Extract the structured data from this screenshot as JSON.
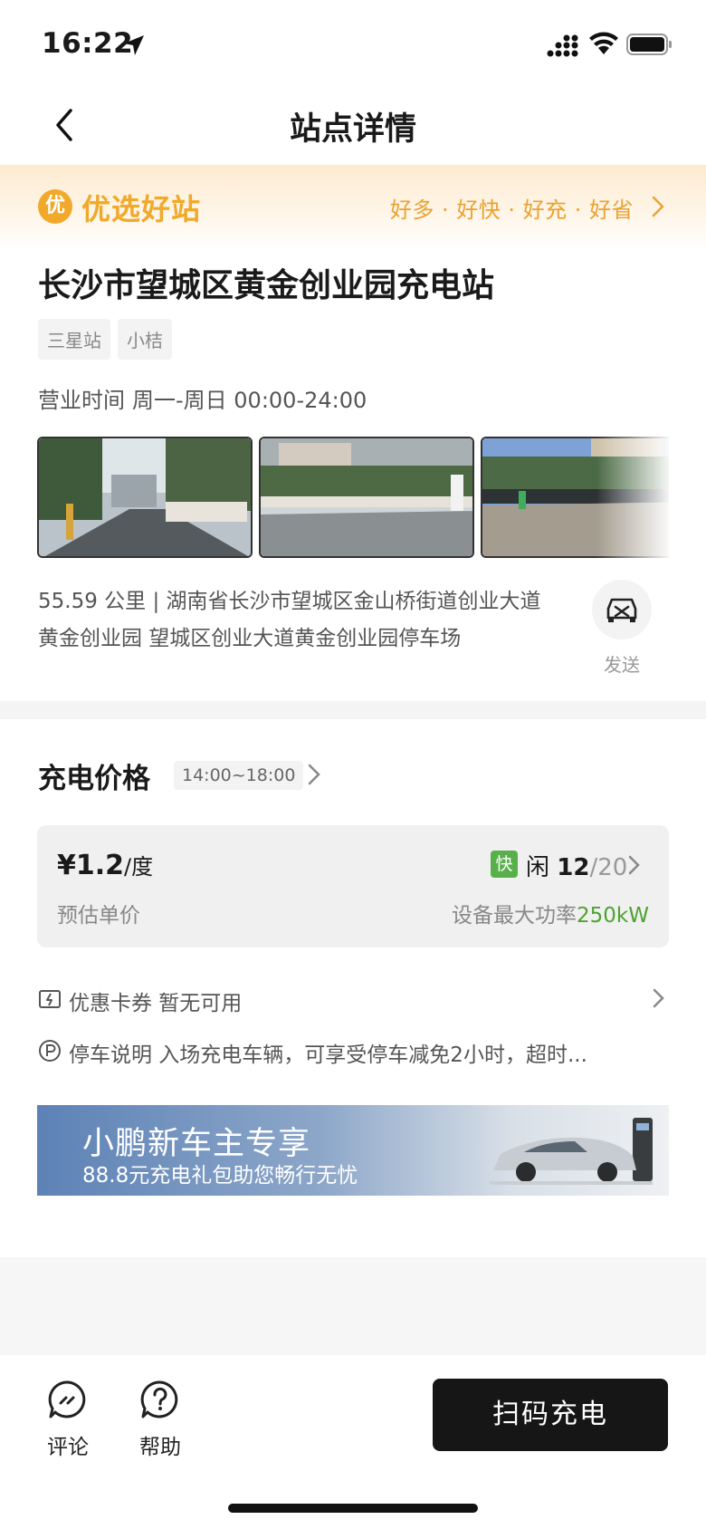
{
  "status_bar": {
    "time": "16:22"
  },
  "nav": {
    "title": "站点详情"
  },
  "promo": {
    "badge": "优",
    "title": "优选好站",
    "slogan": "好多 · 好快 · 好充 · 好省"
  },
  "station": {
    "name": "长沙市望城区黄金创业园充电站",
    "tags": [
      "三星站",
      "小桔"
    ],
    "hours_label": "营业时间",
    "hours_value": "周一-周日 00:00-24:00",
    "address": "55.59 公里 | 湖南省长沙市望城区金山桥街道创业大道黄金创业园 望城区创业大道黄金创业园停车场",
    "send_label": "发送"
  },
  "price": {
    "title": "充电价格",
    "time_range": "14:00~18:00",
    "value": "¥1.2",
    "unit": "/度",
    "sub_label": "预估单价",
    "fast_badge": "快",
    "idle_label": "闲",
    "idle_count": "12",
    "total_count": "/20",
    "power_label": "设备最大功率",
    "power_value": "250kW"
  },
  "coupon": {
    "text": "优惠卡券 暂无可用"
  },
  "parking": {
    "text": "停车说明 入场充电车辆，可享受停车减免2小时，超时..."
  },
  "banner": {
    "title": "小鹏新车主专享",
    "subtitle": "88.8元充电礼包助您畅行无忧"
  },
  "bottom": {
    "comment_label": "评论",
    "help_label": "帮助",
    "scan_label": "扫码充电"
  },
  "colors": {
    "accent_orange": "#f0a92a",
    "fast_green": "#58b04b",
    "power_green": "#4ea32f",
    "scan_button": "#161616"
  }
}
